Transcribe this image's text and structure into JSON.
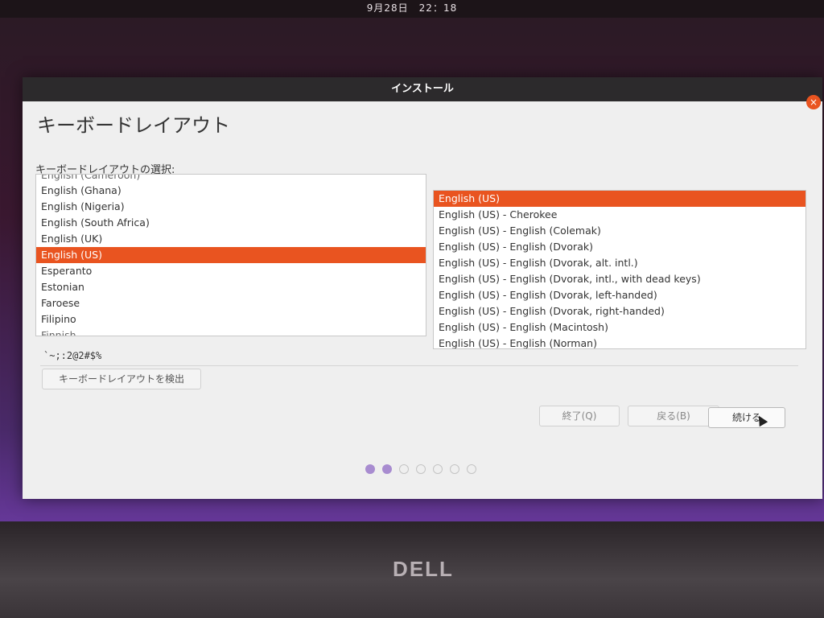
{
  "topbar": {
    "datetime": "9月28日　22：18"
  },
  "window": {
    "title": "インストール",
    "close_symbol": "×",
    "page_title": "キーボードレイアウト",
    "section_label": "キーボードレイアウトの選択:"
  },
  "layouts_list": {
    "partial_top": "English (Cameroon)",
    "items": [
      "English (Ghana)",
      "English (Nigeria)",
      "English (South Africa)",
      "English (UK)",
      "English (US)",
      "Esperanto",
      "Estonian",
      "Faroese",
      "Filipino"
    ],
    "selected": "English (US)",
    "partial_bottom": "Finnish"
  },
  "variants_list": {
    "items": [
      "English (US)",
      "English (US) - Cherokee",
      "English (US) - English (Colemak)",
      "English (US) - English (Dvorak)",
      "English (US) - English (Dvorak, alt. intl.)",
      "English (US) - English (Dvorak, intl., with dead keys)",
      "English (US) - English (Dvorak, left-handed)",
      "English (US) - English (Dvorak, right-handed)",
      "English (US) - English (Macintosh)",
      "English (US) - English (Norman)"
    ],
    "selected": "English (US)"
  },
  "test_input": {
    "value": "`~;:2@2#$%"
  },
  "buttons": {
    "detect": "キーボードレイアウトを検出",
    "quit": "終了(Q)",
    "back": "戻る(B)",
    "continue": "続ける"
  },
  "progress": {
    "total_steps": 7,
    "current_step": 2
  },
  "bezel": {
    "brand": "DELL"
  },
  "colors": {
    "accent": "#e95420",
    "progress_active": "#a88cd0"
  }
}
